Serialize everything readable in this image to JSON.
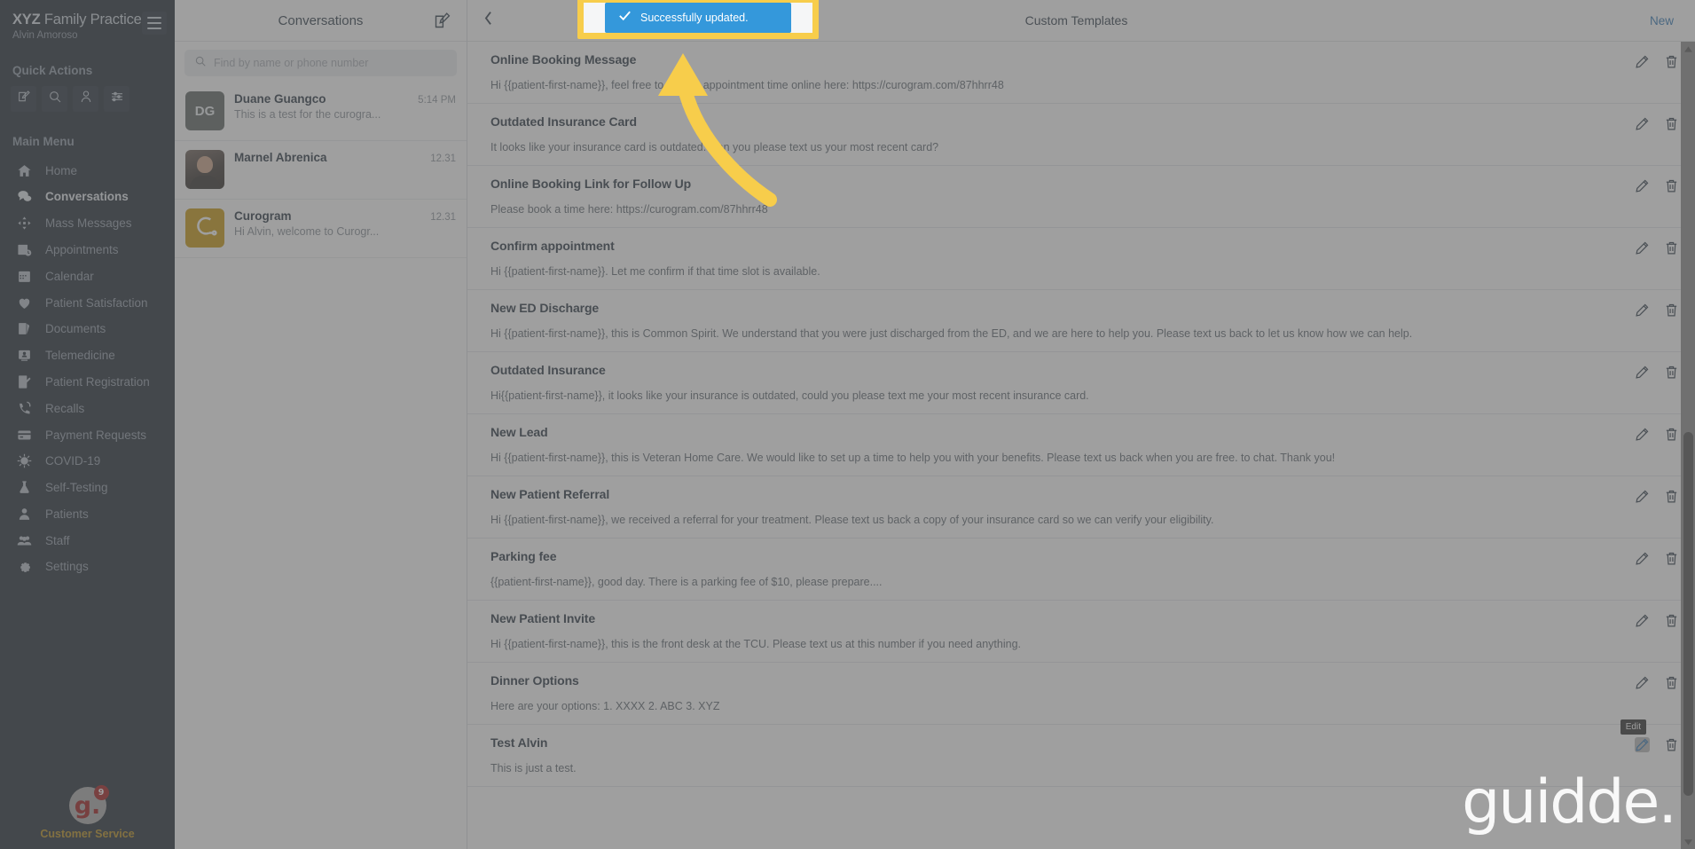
{
  "colors": {
    "sidebar_bg": "#1d2631",
    "accent_blue": "#2f77b5",
    "toast_blue": "#3498db",
    "highlight_yellow": "#f7cd4b",
    "customer_service": "#b88c14"
  },
  "sidebar": {
    "brand_bold": "XYZ",
    "brand_rest": " Family Practice",
    "user_name": "Alvin Amoroso",
    "menu_button": "menu",
    "quick_actions_label": "Quick Actions",
    "quick_actions": [
      {
        "name": "compose-icon"
      },
      {
        "name": "search-icon"
      },
      {
        "name": "add-patient-icon"
      },
      {
        "name": "filters-icon"
      }
    ],
    "main_menu_label": "Main Menu",
    "items": [
      {
        "label": "Home",
        "icon": "home-icon",
        "active": false
      },
      {
        "label": "Conversations",
        "icon": "chat-icon",
        "active": true
      },
      {
        "label": "Mass Messages",
        "icon": "broadcast-icon",
        "active": false
      },
      {
        "label": "Appointments",
        "icon": "appointments-icon",
        "active": false
      },
      {
        "label": "Calendar",
        "icon": "calendar-icon",
        "active": false
      },
      {
        "label": "Patient Satisfaction",
        "icon": "heart-icon",
        "active": false
      },
      {
        "label": "Documents",
        "icon": "documents-icon",
        "active": false
      },
      {
        "label": "Telemedicine",
        "icon": "telemedicine-icon",
        "active": false
      },
      {
        "label": "Patient Registration",
        "icon": "registration-icon",
        "active": false
      },
      {
        "label": "Recalls",
        "icon": "recall-phone-icon",
        "active": false
      },
      {
        "label": "Payment Requests",
        "icon": "credit-card-icon",
        "active": false
      },
      {
        "label": "COVID-19",
        "icon": "virus-icon",
        "active": false
      },
      {
        "label": "Self-Testing",
        "icon": "flask-icon",
        "active": false
      },
      {
        "label": "Patients",
        "icon": "person-icon",
        "active": false
      },
      {
        "label": "Staff",
        "icon": "people-icon",
        "active": false
      },
      {
        "label": "Settings",
        "icon": "gear-icon",
        "active": false
      }
    ],
    "customer_service": {
      "logo_text": "g.",
      "badge_count": "9",
      "label": "Customer Service"
    }
  },
  "conversations": {
    "title": "Conversations",
    "compose_icon": "compose-icon",
    "search_placeholder": "Find by name or phone number",
    "search_value": "",
    "items": [
      {
        "name": "Duane Guangco",
        "time": "5:14 PM",
        "preview": "This is a test for the curogra...",
        "avatar_kind": "initials",
        "initials": "DG"
      },
      {
        "name": "Marnel Abrenica",
        "time": "12.31",
        "preview": "",
        "avatar_kind": "photo",
        "initials": ""
      },
      {
        "name": "Curogram",
        "time": "12.31",
        "preview": "Hi Alvin, welcome to Curogr...",
        "avatar_kind": "logo",
        "initials": ""
      }
    ]
  },
  "main": {
    "back_icon": "chevron-left-icon",
    "title": "Custom Templates",
    "new_label": "New",
    "edit_icon": "pencil-icon",
    "delete_icon": "trash-icon",
    "edit_tooltip": "Edit",
    "templates": [
      {
        "name": "Online Booking Message",
        "text": "Hi {{patient-first-name}}, feel free to find an appointment time online here: https://curogram.com/87hhrr48"
      },
      {
        "name": "Outdated Insurance Card",
        "text": "It looks like your insurance card is outdated. Can you please text us your most recent card?"
      },
      {
        "name": "Online Booking Link for Follow Up",
        "text": "Please book a time here: https://curogram.com/87hhrr48"
      },
      {
        "name": "Confirm appointment",
        "text": "Hi {{patient-first-name}}. Let me confirm if that time slot is available."
      },
      {
        "name": "New ED Discharge",
        "text": "Hi {{patient-first-name}}, this is Common Spirit. We understand that you were just discharged from the ED, and we are here to help you. Please text us back to let us know how we can help."
      },
      {
        "name": "Outdated Insurance",
        "text": "Hi{{patient-first-name}}, it looks like your insurance is outdated, could you please text me your most recent insurance card."
      },
      {
        "name": "New Lead",
        "text": "Hi {{patient-first-name}}, this is Veteran Home Care. We would like to set up a time to help you with your benefits. Please text us back when you are free. to chat. Thank you!"
      },
      {
        "name": "New Patient Referral",
        "text": "Hi {{patient-first-name}}, we received a referral for your treatment. Please text us back a copy of your insurance card so we can verify your eligibility."
      },
      {
        "name": "Parking fee",
        "text": "{{patient-first-name}}, good day. There is a parking fee of $10, please prepare...."
      },
      {
        "name": "New Patient Invite",
        "text": "Hi {{patient-first-name}}, this is the front desk at the TCU. Please text us at this number if you need anything."
      },
      {
        "name": "Dinner Options",
        "text": "Here are your options: 1. XXXX 2. ABC 3. XYZ"
      },
      {
        "name": "Test Alvin",
        "text": "This is just a test."
      }
    ]
  },
  "toast": {
    "message": "Successfully updated.",
    "icon": "check-icon"
  },
  "watermark": {
    "text": "guidde."
  }
}
